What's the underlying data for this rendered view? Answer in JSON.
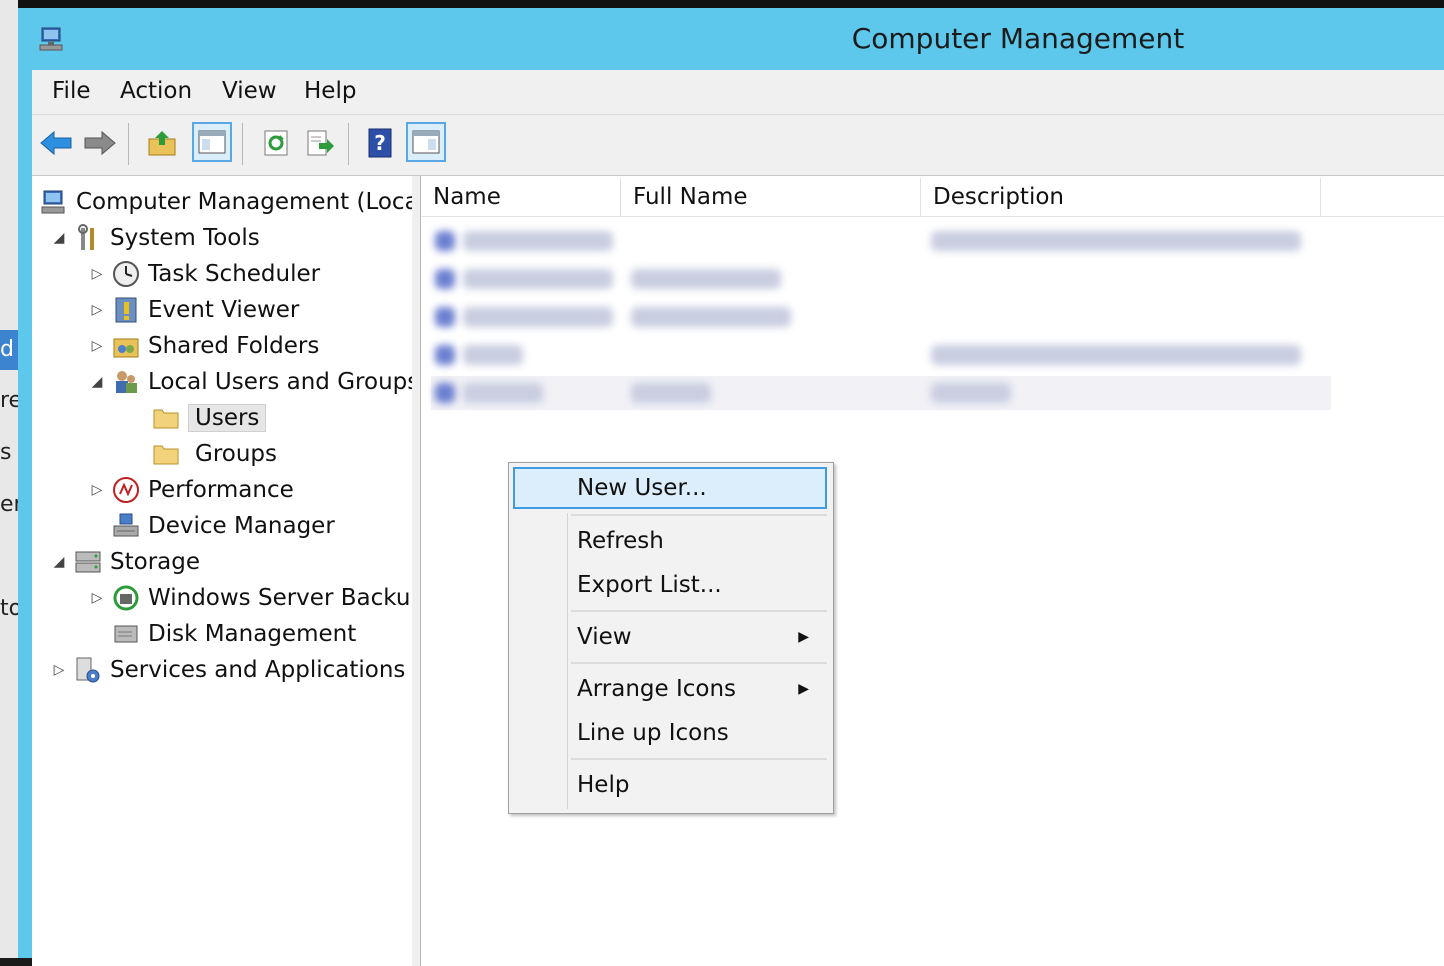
{
  "background": {
    "fragments": [
      "d",
      "re",
      "s",
      "er",
      "to"
    ]
  },
  "window": {
    "title": "Computer Management",
    "titlebar_color": "#5ec8ec"
  },
  "menubar": {
    "items": [
      "File",
      "Action",
      "View",
      "Help"
    ]
  },
  "toolbar": {
    "buttons": [
      "back-icon",
      "forward-icon",
      "up-folder-icon",
      "show-hide-console-tree-icon",
      "refresh-icon",
      "export-list-icon",
      "help-icon",
      "show-hide-action-pane-icon"
    ]
  },
  "tree": {
    "items": [
      {
        "label": "Computer Management (Local",
        "icon": "computer-management-icon",
        "expander": ""
      },
      {
        "label": "System Tools",
        "icon": "tools-icon",
        "expander": "◢"
      },
      {
        "label": "Task Scheduler",
        "icon": "clock-icon",
        "expander": "▷"
      },
      {
        "label": "Event Viewer",
        "icon": "event-viewer-icon",
        "expander": "▷"
      },
      {
        "label": "Shared Folders",
        "icon": "shared-folder-icon",
        "expander": "▷"
      },
      {
        "label": "Local Users and Groups",
        "icon": "users-groups-icon",
        "expander": "◢"
      },
      {
        "label": "Users",
        "icon": "folder-icon",
        "expander": ""
      },
      {
        "label": "Groups",
        "icon": "folder-icon",
        "expander": ""
      },
      {
        "label": "Performance",
        "icon": "performance-icon",
        "expander": "▷"
      },
      {
        "label": "Device Manager",
        "icon": "device-manager-icon",
        "expander": ""
      },
      {
        "label": "Storage",
        "icon": "storage-icon",
        "expander": "◢"
      },
      {
        "label": "Windows Server Backup",
        "icon": "backup-icon",
        "expander": "▷"
      },
      {
        "label": "Disk Management",
        "icon": "disk-icon",
        "expander": ""
      },
      {
        "label": "Services and Applications",
        "icon": "services-icon",
        "expander": "▷"
      }
    ],
    "selected": "Users"
  },
  "list": {
    "columns": [
      "Name",
      "Full Name",
      "Description"
    ],
    "row_count": 5
  },
  "context_menu": {
    "items": [
      "New User...",
      "Refresh",
      "Export List...",
      "View",
      "Arrange Icons",
      "Line up Icons",
      "Help"
    ],
    "highlighted": "New User..."
  }
}
